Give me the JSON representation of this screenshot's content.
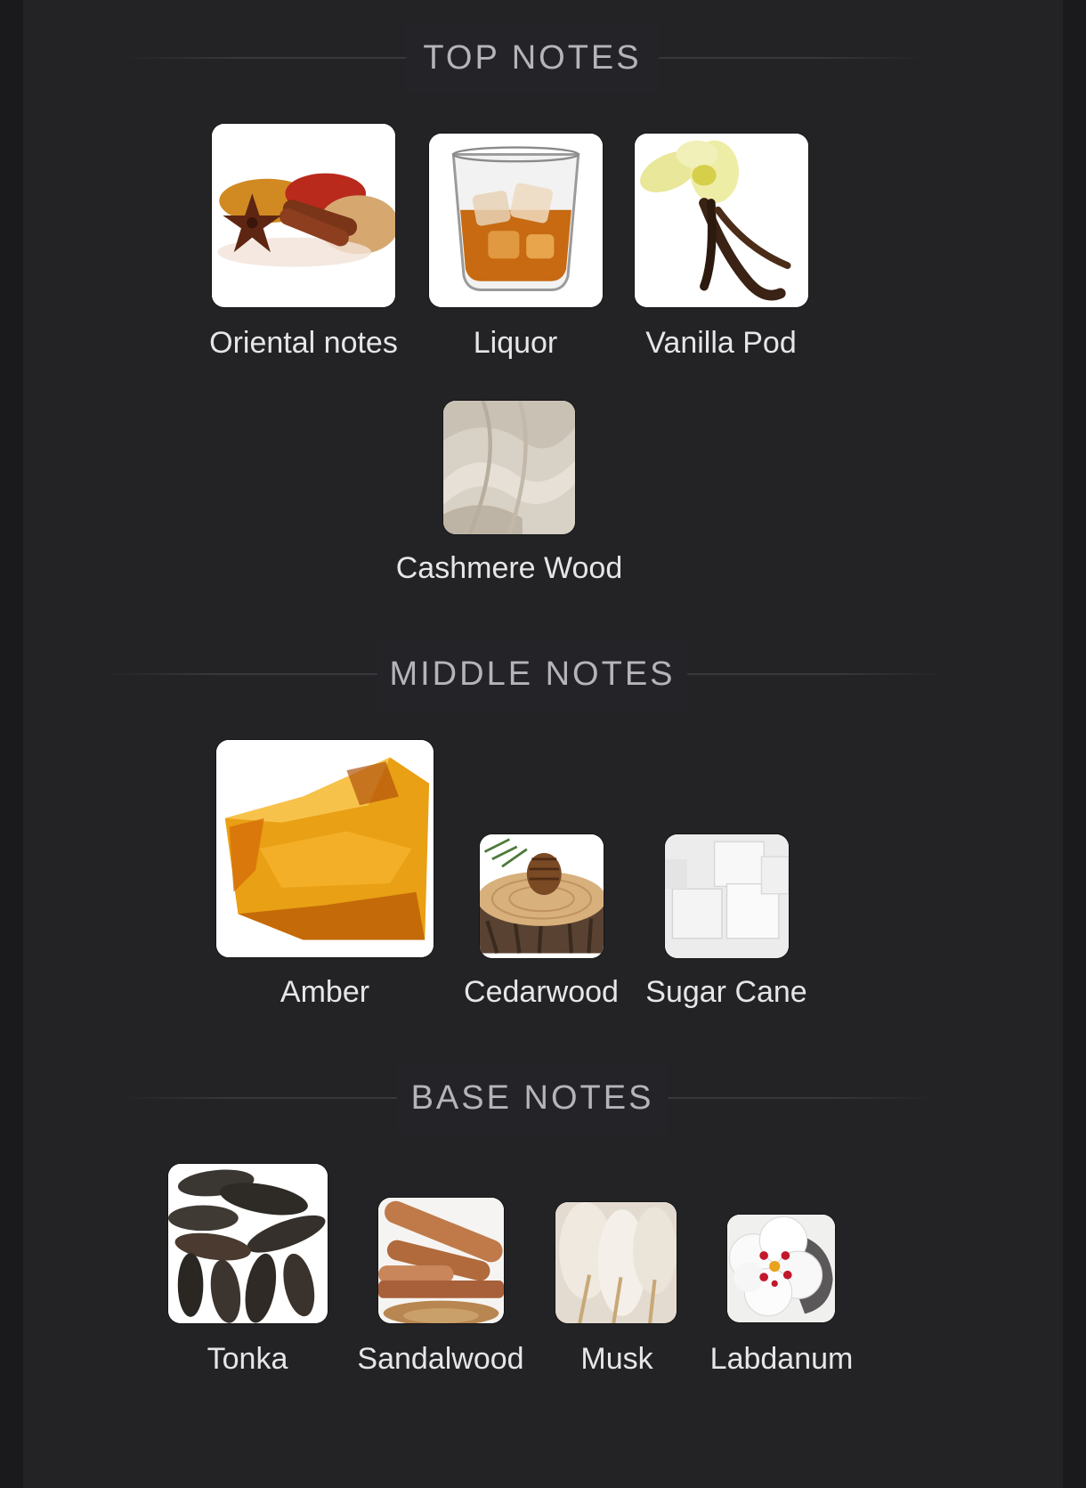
{
  "sections": {
    "top": {
      "title": "TOP NOTES",
      "notes": [
        {
          "label": "Oriental notes",
          "icon": "spices-icon"
        },
        {
          "label": "Liquor",
          "icon": "whisky-glass-icon"
        },
        {
          "label": "Vanilla Pod",
          "icon": "vanilla-flower-icon"
        },
        {
          "label": "Cashmere Wood",
          "icon": "cashmere-fabric-icon"
        }
      ]
    },
    "middle": {
      "title": "MIDDLE NOTES",
      "notes": [
        {
          "label": "Amber",
          "icon": "amber-resin-icon"
        },
        {
          "label": "Cedarwood",
          "icon": "cedar-log-icon"
        },
        {
          "label": "Sugar Cane",
          "icon": "sugar-cubes-icon"
        }
      ]
    },
    "base": {
      "title": "BASE NOTES",
      "notes": [
        {
          "label": "Tonka",
          "icon": "tonka-beans-icon"
        },
        {
          "label": "Sandalwood",
          "icon": "sandalwood-sticks-icon"
        },
        {
          "label": "Musk",
          "icon": "musk-fur-icon"
        },
        {
          "label": "Labdanum",
          "icon": "labdanum-flower-icon"
        }
      ]
    }
  }
}
